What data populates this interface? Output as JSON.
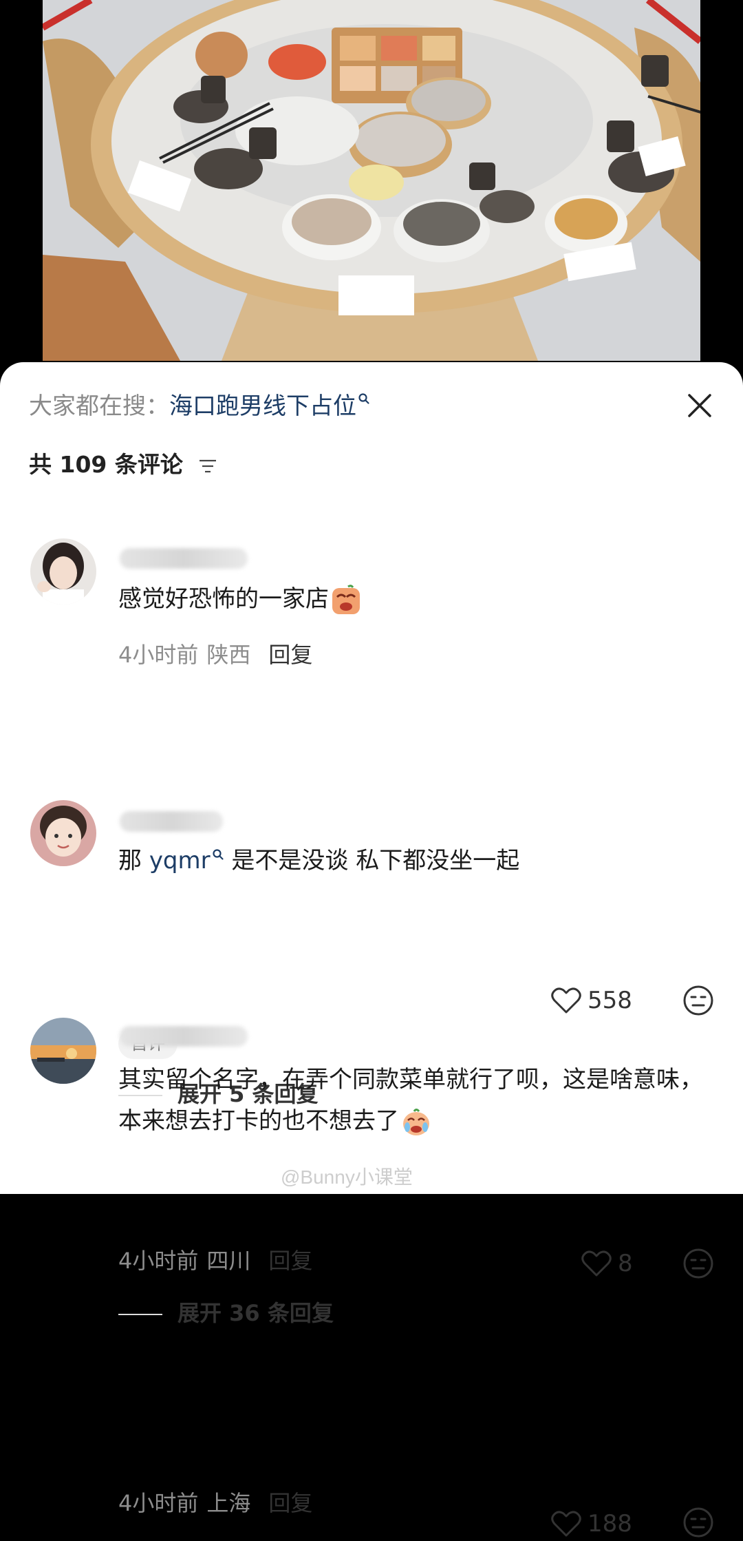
{
  "search_bar": {
    "prefix": "大家都在搜：",
    "term": "海口跑男线下占位"
  },
  "comment_count": {
    "prefix": "共",
    "number": "109",
    "suffix": "条评论"
  },
  "comments": [
    {
      "text": "感觉好恐怖的一家店",
      "emoji": "sad-face-emoji",
      "time": "4小时前",
      "region": "陕西",
      "reply_label": "回复",
      "likes": "558",
      "badge": "首评",
      "expand_label": "展开 5 条回复"
    },
    {
      "text_before": "那 ",
      "mention": "yqmr",
      "text_after": " 是不是没谈 私下都没坐一起",
      "time": "4小时前",
      "region": "四川",
      "reply_label": "回复",
      "likes": "8",
      "expand_label": "展开 36 条回复"
    },
    {
      "text": "其实留个名字，在弄个同款菜单就行了呗，这是啥意味，本来想去打卡的也不想去了",
      "emoji": "crying-face-emoji",
      "time": "4小时前",
      "region": "上海",
      "reply_label": "回复",
      "likes": "188"
    }
  ],
  "watermark": "@Bunny小课堂",
  "colors": {
    "link": "#1d3d66",
    "muted": "#8d8d8d",
    "sheet": "#ffffff"
  }
}
